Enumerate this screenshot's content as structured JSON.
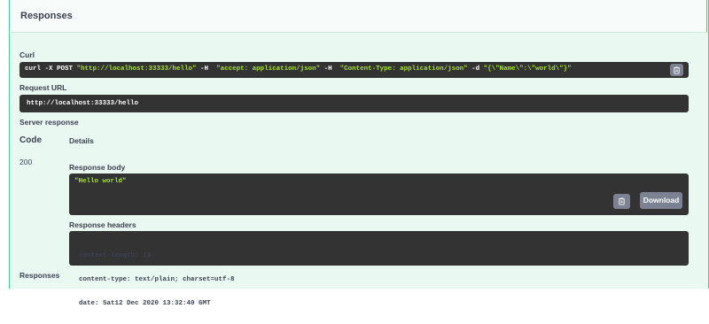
{
  "section": {
    "title": "Responses"
  },
  "curl": {
    "label": "Curl",
    "segments": [
      {
        "text": "curl -X POST ",
        "kind": "plain"
      },
      {
        "text": "\"http://localhost:33333/hello\"",
        "kind": "str"
      },
      {
        "text": " -H  ",
        "kind": "plain"
      },
      {
        "text": "\"accept: application/json\"",
        "kind": "str"
      },
      {
        "text": " -H  ",
        "kind": "plain"
      },
      {
        "text": "\"Content-Type: application/json\"",
        "kind": "str"
      },
      {
        "text": " -d ",
        "kind": "plain"
      },
      {
        "text": "\"{\\\"Name\\\":\\\"world\\\"}\"",
        "kind": "str"
      }
    ]
  },
  "request_url": {
    "label": "Request URL",
    "value": "http://localhost:33333/hello"
  },
  "server_response": {
    "label": "Server response",
    "col_code": "Code",
    "col_details": "Details",
    "code": "200",
    "body_label": "Response body",
    "body_value": "\"Hello world\"",
    "download_label": "Download",
    "headers_label": "Response headers",
    "headers": [
      "content-length: 13",
      "content-type: text/plain; charset=utf-8",
      "date: Sat12 Dec 2020 13:32:40 GMT"
    ]
  },
  "footer": {
    "label": "Responses"
  },
  "colors": {
    "accent": "#49cc90",
    "code_bg": "#333333",
    "string": "#a6e22e",
    "button": "#7d8293"
  },
  "icons": {
    "copy": "clipboard-icon"
  }
}
